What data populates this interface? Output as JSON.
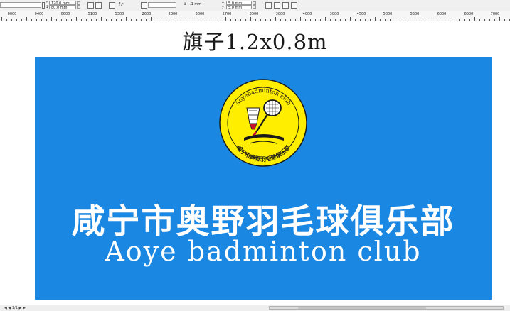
{
  "propbar": {
    "object_origin_value": "",
    "width_value": "120.0 mm",
    "height_value": "80.0 mm",
    "scale_x": "100.0",
    "scale_y": "100.0",
    "rotation_value": "",
    "nudge_value": ".1 mm",
    "dup_x": "5.0 mm",
    "dup_y": "5.0 mm",
    "outline_value": ""
  },
  "ruler": {
    "labels": [
      "0000",
      "0400",
      "0600",
      "5100",
      "5300",
      "2600",
      "2800",
      "3000",
      "2700",
      "3500",
      "3000",
      "4000",
      "3000",
      "4500",
      "5000",
      "5500",
      "6000",
      "6500",
      "7000"
    ]
  },
  "canvas": {
    "caption": "旗子1.2x0.8m",
    "flag_color": "#1a87e2",
    "club_name_cn": "咸宁市奥野羽毛球俱乐部",
    "club_name_en": "Aoye badminton club",
    "logo": {
      "ring_text_top": "Aoyebadminton club",
      "ring_text_bottom": "咸宁市奥野羽毛球俱乐部",
      "yellow": "#ffee00",
      "accent": "#c8102e"
    }
  },
  "statusbar": {
    "page_nav": "◀ ◀ 1/1 ▶ ▶"
  }
}
